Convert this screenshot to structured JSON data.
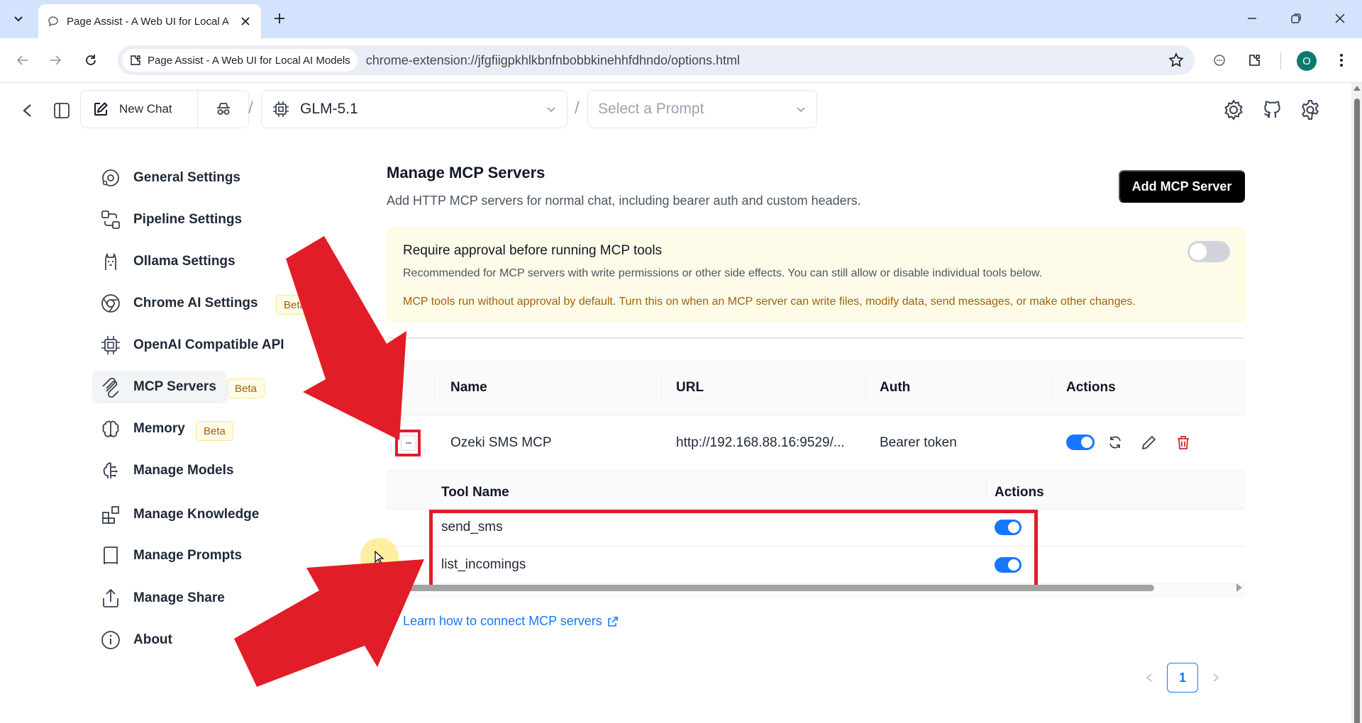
{
  "browser": {
    "tab_title": "Page Assist - A Web UI for Local AI Models",
    "site_chip": "Page Assist - A Web UI for Local AI Models",
    "url": "chrome-extension://jfgfiigpkhlkbnfnbobbkinehhfdhndo/options.html",
    "profile_initial": "O"
  },
  "header": {
    "new_chat": "New Chat",
    "model": "GLM-5.1",
    "prompt_placeholder": "Select a Prompt",
    "separator": "/"
  },
  "nav": {
    "items": [
      {
        "label": "General Settings",
        "icon": "general-settings-icon"
      },
      {
        "label": "Pipeline Settings",
        "icon": "pipeline-icon"
      },
      {
        "label": "Ollama Settings",
        "icon": "llama-icon"
      },
      {
        "label": "Chrome AI Settings",
        "icon": "chrome-icon",
        "badge": "Beta"
      },
      {
        "label": "OpenAI Compatible API",
        "icon": "cpu-chip-icon"
      },
      {
        "label": "MCP Servers",
        "icon": "mcp-icon",
        "badge": "Beta",
        "active": true
      },
      {
        "label": "Memory",
        "icon": "brain-icon",
        "badge": "Beta"
      },
      {
        "label": "Manage Models",
        "icon": "models-icon"
      },
      {
        "label": "Manage Knowledge",
        "icon": "blocks-icon"
      },
      {
        "label": "Manage Prompts",
        "icon": "book-icon"
      },
      {
        "label": "Manage Share",
        "icon": "share-icon"
      },
      {
        "label": "About",
        "icon": "info-icon"
      }
    ]
  },
  "main": {
    "title": "Manage MCP Servers",
    "subtitle": "Add HTTP MCP servers for normal chat, including bearer auth and custom headers.",
    "add_button": "Add MCP Server",
    "approval": {
      "title": "Require approval before running MCP tools",
      "description": "Recommended for MCP servers with write permissions or other side effects. You can still allow or disable individual tools below.",
      "warning": "MCP tools run without approval by default. Turn this on when an MCP server can write files, modify data, send messages, or make other changes.",
      "enabled": false
    },
    "table": {
      "columns": [
        "Name",
        "URL",
        "Auth",
        "Actions"
      ],
      "rows": [
        {
          "name": "Ozeki SMS MCP",
          "url": "http://192.168.88.16:9529/...",
          "auth": "Bearer token",
          "enabled": true
        }
      ]
    },
    "tools": {
      "columns": [
        "Tool Name",
        "Actions"
      ],
      "rows": [
        {
          "name": "send_sms",
          "enabled": true
        },
        {
          "name": "list_incomings",
          "enabled": true
        }
      ]
    },
    "learn_link": "Learn how to connect MCP servers",
    "pagination": {
      "current": "1"
    }
  },
  "colors": {
    "accent": "#1677ff",
    "annotation_red": "#e11d27",
    "tabstrip": "#d3e3fd"
  }
}
